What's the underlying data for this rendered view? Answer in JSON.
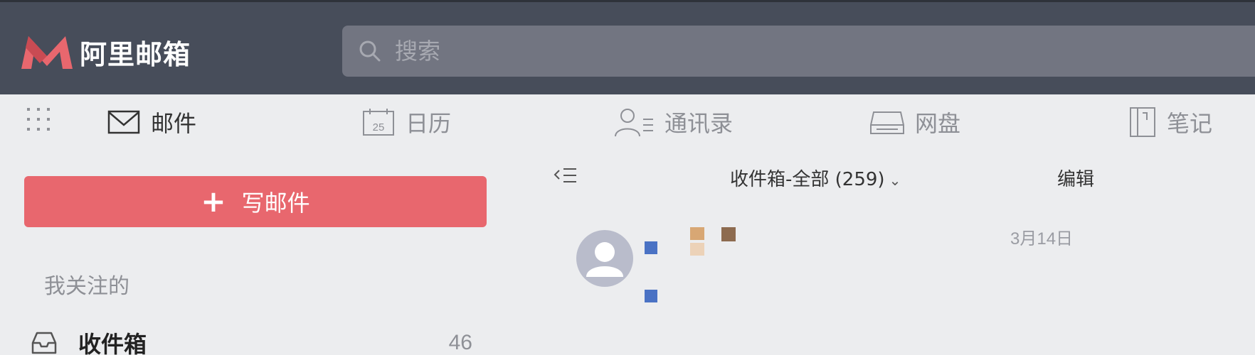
{
  "app": {
    "name": "阿里邮箱",
    "brand_color": "#e8676e",
    "header_color": "#474d5a"
  },
  "search": {
    "placeholder": "搜索",
    "icon": "search-icon"
  },
  "nav": {
    "items": [
      {
        "label": "邮件",
        "icon": "mail-icon",
        "active": true
      },
      {
        "label": "日历",
        "icon": "calendar-icon",
        "calendar_day": "25"
      },
      {
        "label": "通讯录",
        "icon": "contacts-icon"
      },
      {
        "label": "网盘",
        "icon": "drive-icon"
      },
      {
        "label": "笔记",
        "icon": "notes-icon"
      }
    ],
    "apps_icon": "apps-grid-icon"
  },
  "sidebar": {
    "compose_label": "写邮件",
    "section_label": "我关注的",
    "folders": [
      {
        "name": "收件箱",
        "count": "46",
        "icon": "inbox-icon"
      }
    ]
  },
  "mail_list": {
    "folder_title": "收件箱-全部 (259)",
    "edit_label": "编辑",
    "messages": [
      {
        "date": "3月14日"
      }
    ]
  }
}
